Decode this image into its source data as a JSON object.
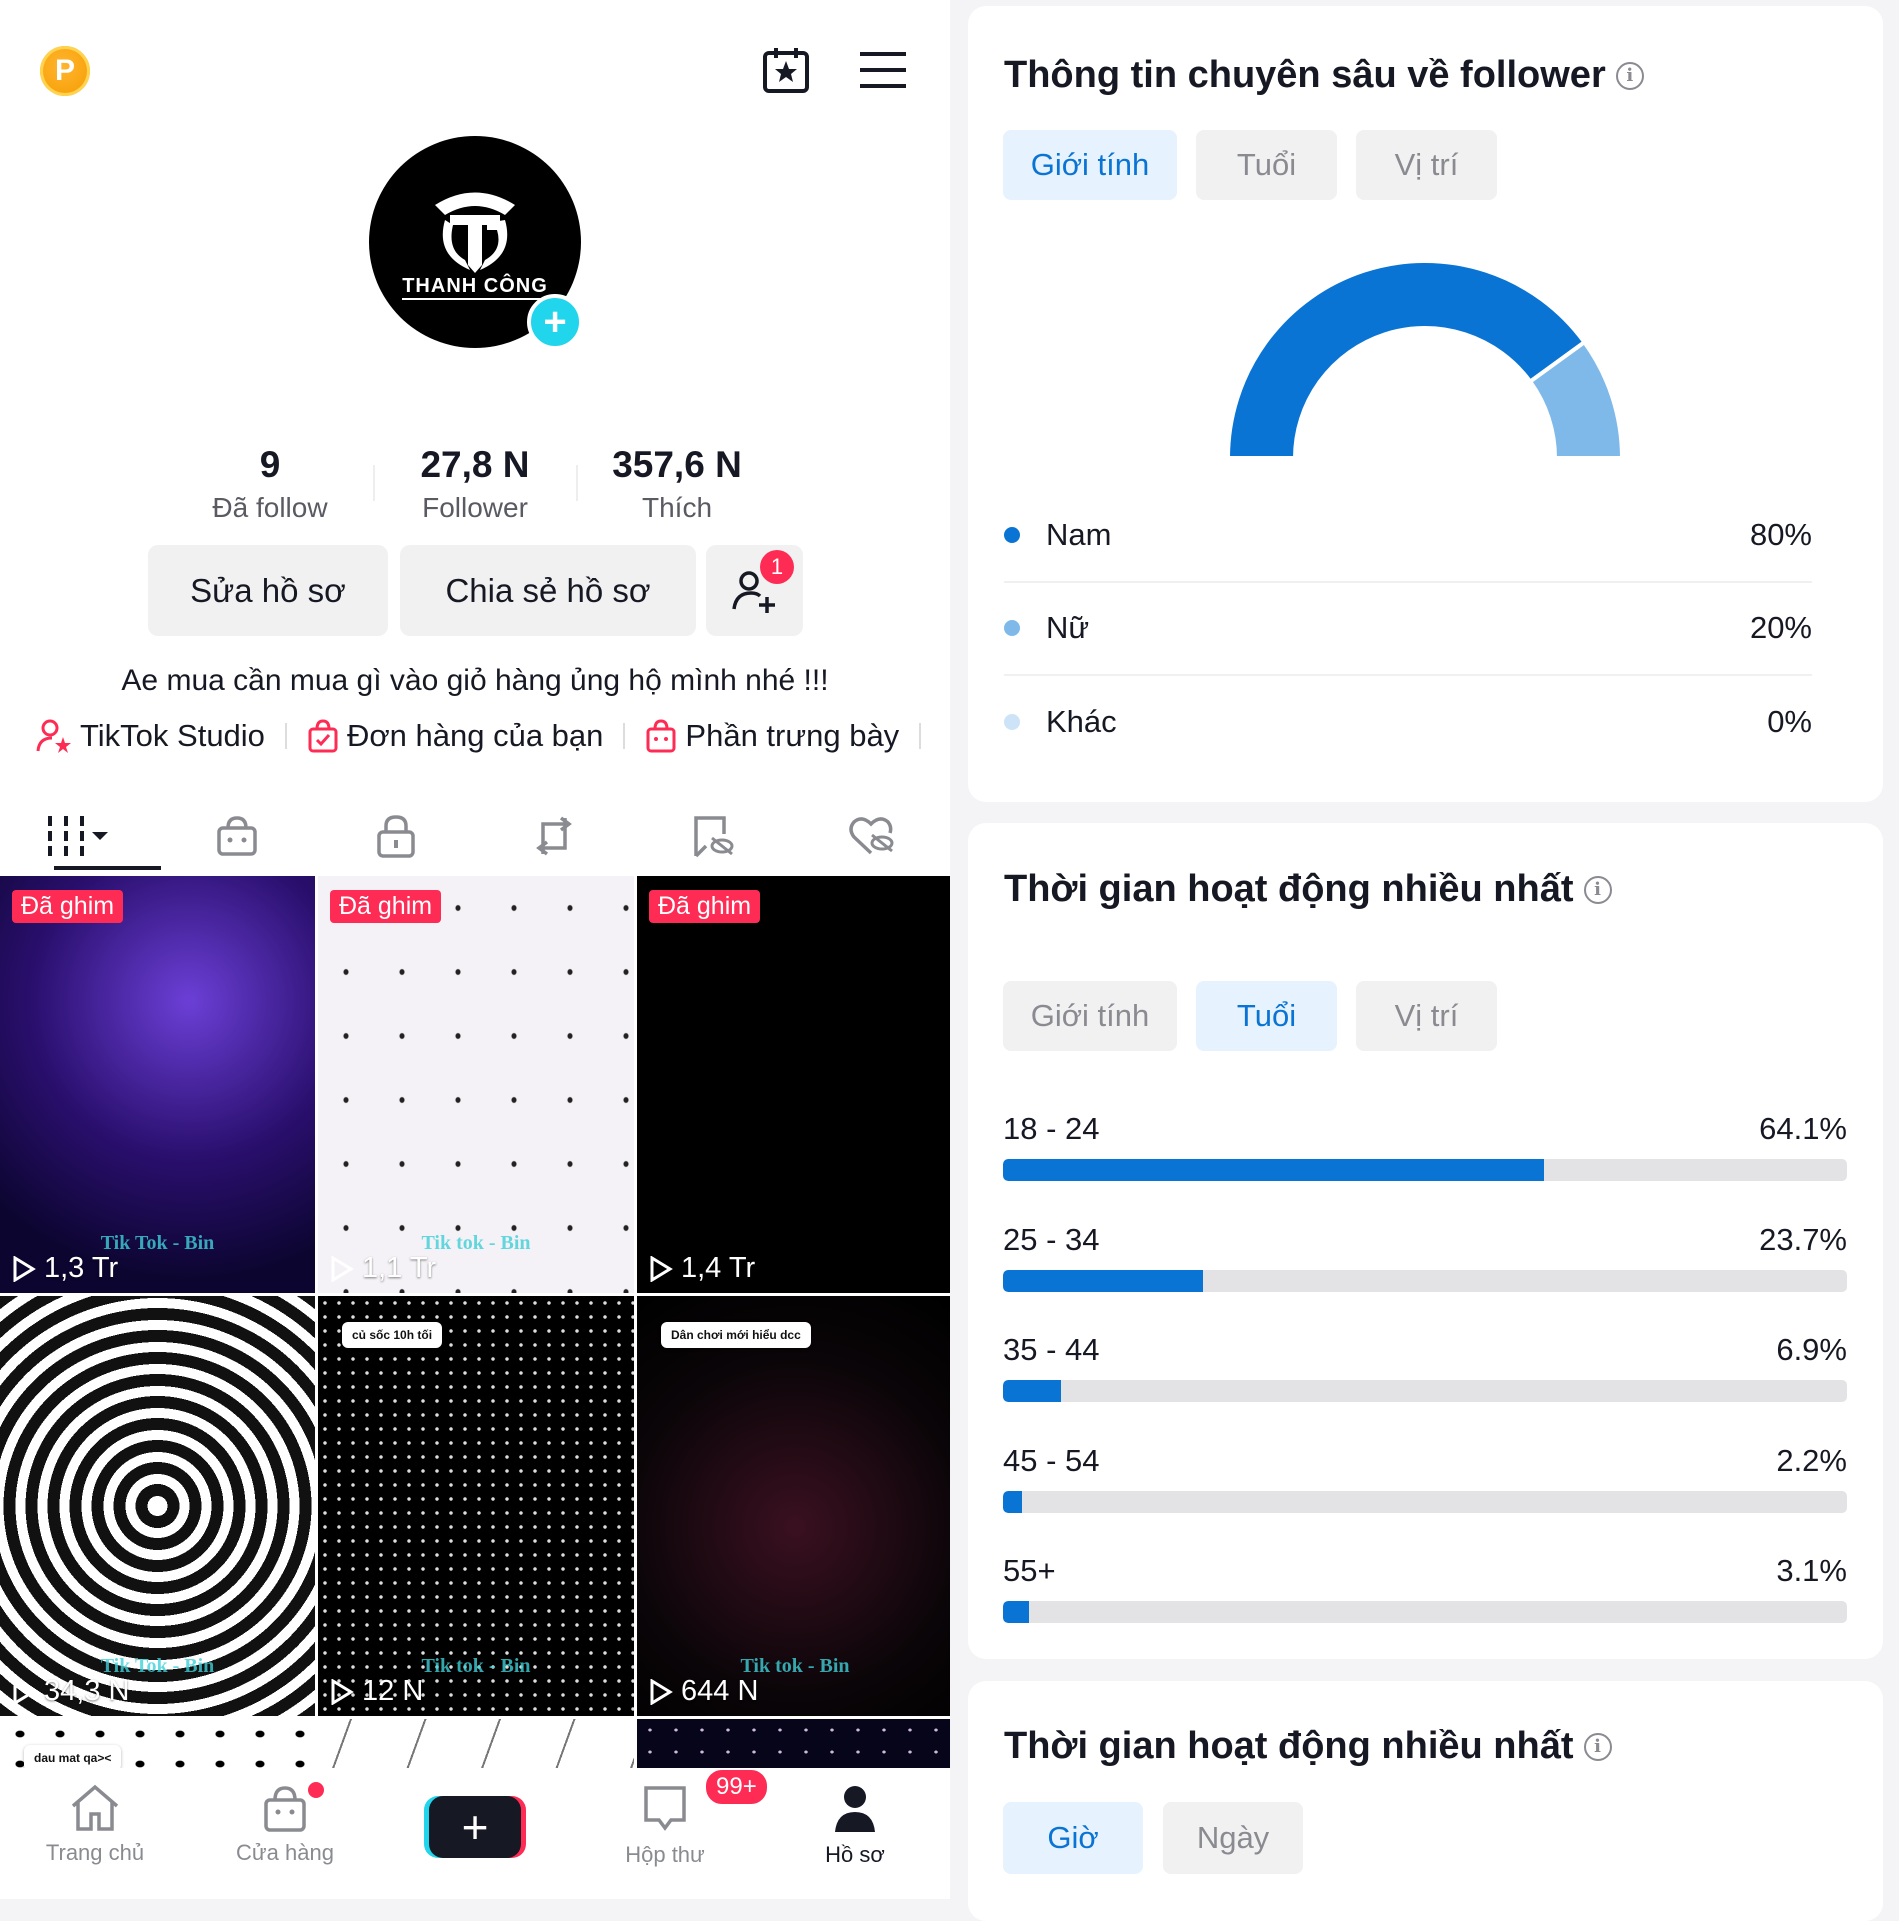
{
  "header": {
    "coin_letter": "P",
    "icons": [
      "calendar-star-icon",
      "menu-icon"
    ]
  },
  "profile": {
    "avatar_text": "THANH CÔNG",
    "stats": [
      {
        "value": "9",
        "label": "Đã follow"
      },
      {
        "value": "27,8 N",
        "label": "Follower"
      },
      {
        "value": "357,6 N",
        "label": "Thích"
      }
    ],
    "edit_label": "Sửa hồ sơ",
    "share_label": "Chia sẻ hồ sơ",
    "friend_badge": "1",
    "bio": "Ae mua cần mua gì vào giỏ hàng ủng hộ mình nhé !!!",
    "links": [
      "TikTok Studio",
      "Đơn hàng của bạn",
      "Phần trưng bày"
    ]
  },
  "videos": [
    {
      "pinned": "Đã ghim",
      "views": "1,3 Tr",
      "watermark": "Tik Tok - Bin"
    },
    {
      "pinned": "Đã ghim",
      "views": "1,1 Tr",
      "watermark": "Tik tok - Bin"
    },
    {
      "pinned": "Đã ghim",
      "views": "1,4 Tr",
      "watermark": ""
    },
    {
      "views": "34,3 N",
      "watermark": "Tik Tok - Bin"
    },
    {
      "views": "12 N",
      "watermark": "Tik tok - Bin",
      "comment": "củ sốc 10h tối"
    },
    {
      "views": "644 N",
      "watermark": "Tik tok - Bin",
      "comment": "Dân chơi mới hiểu dcc"
    },
    {
      "comment": "dau mat qa><"
    },
    {},
    {}
  ],
  "nav": {
    "items": [
      "Trang chủ",
      "Cửa hàng",
      "",
      "Hộp thư",
      "Hồ sơ"
    ],
    "inbox_badge": "99+"
  },
  "gender_card": {
    "title": "Thông tin chuyên sâu về follower",
    "tabs": [
      "Giới tính",
      "Tuổi",
      "Vị trí"
    ],
    "active_tab": "Giới tính",
    "chart_data": {
      "type": "pie",
      "variant": "semi-donut",
      "categories": [
        "Nam",
        "Nữ",
        "Khác"
      ],
      "values": [
        80,
        20,
        0
      ],
      "labels": [
        "80%",
        "20%",
        "0%"
      ],
      "colors": [
        "#0a74d4",
        "#7fb9ea",
        "#cde3f7"
      ]
    }
  },
  "age_card": {
    "title": "Thời gian hoạt động nhiều nhất",
    "tabs": [
      "Giới tính",
      "Tuổi",
      "Vị trí"
    ],
    "active_tab": "Tuổi",
    "chart_data": {
      "type": "bar",
      "orientation": "horizontal",
      "categories": [
        "18 - 24",
        "25 - 34",
        "35 - 44",
        "45 - 54",
        "55+"
      ],
      "values": [
        64.1,
        23.7,
        6.9,
        2.2,
        3.1
      ],
      "labels": [
        "64.1%",
        "23.7%",
        "6.9%",
        "2.2%",
        "3.1%"
      ],
      "xlim": [
        0,
        100
      ],
      "color": "#0a74d4"
    }
  },
  "time_card": {
    "title": "Thời gian hoạt động nhiều nhất",
    "tabs": [
      "Giờ",
      "Ngày"
    ],
    "active_tab": "Giờ"
  }
}
